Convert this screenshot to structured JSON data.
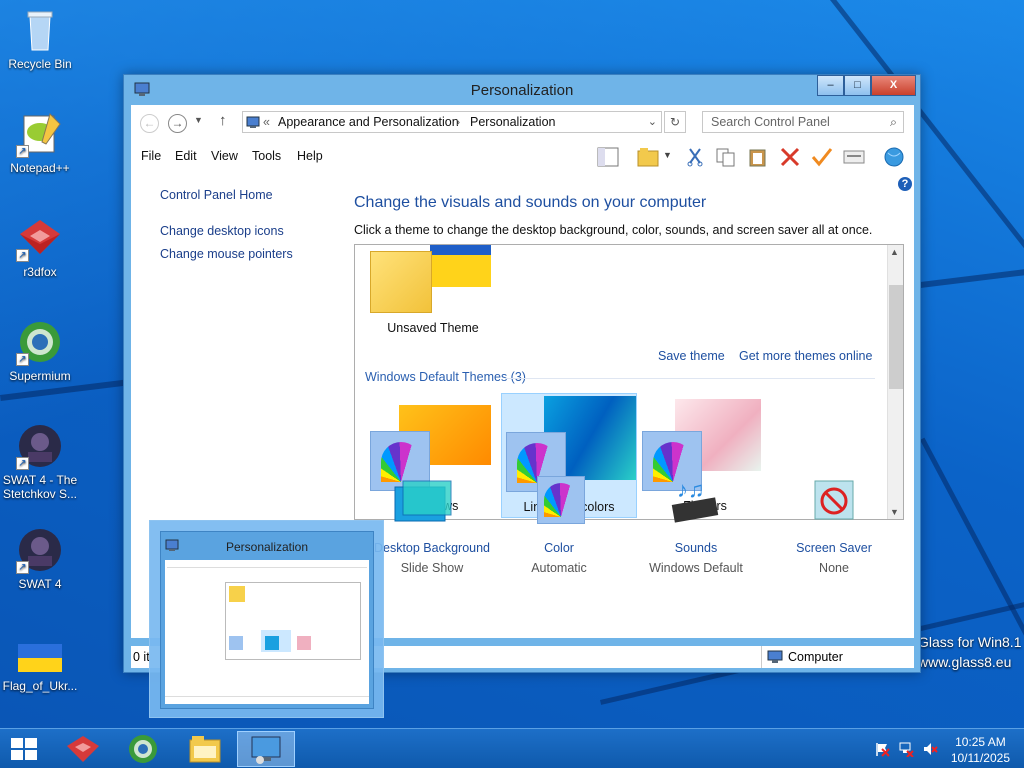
{
  "desktop": {
    "icons": [
      {
        "label": "Recycle Bin"
      },
      {
        "label": "Notepad++"
      },
      {
        "label": "r3dfox"
      },
      {
        "label": "Supermium"
      },
      {
        "label": "SWAT 4 - The Stetchkov S..."
      },
      {
        "label": "SWAT 4"
      },
      {
        "label": "Flag_of_Ukr..."
      }
    ],
    "watermark_line1": "Glass for Win8.1",
    "watermark_line2": "www.glass8.eu"
  },
  "window": {
    "title": "Personalization",
    "controls": {
      "minimize": "–",
      "maximize": "□",
      "close": "X"
    },
    "address": {
      "prefix": "«",
      "crumb1": "Appearance and Personalization",
      "sep": "›",
      "crumb2": "Personalization"
    },
    "search_placeholder": "Search Control Panel",
    "menu": [
      "File",
      "Edit",
      "View",
      "Tools",
      "Help"
    ],
    "sidebar": {
      "home": "Control Panel Home",
      "links": [
        "Change desktop icons",
        "Change mouse pointers"
      ]
    },
    "heading": "Change the visuals and sounds on your computer",
    "subtext": "Click a theme to change the desktop background, color, sounds, and screen saver all at once.",
    "my_themes": {
      "unsaved": "Unsaved Theme",
      "save_link": "Save theme",
      "more_link": "Get more themes online"
    },
    "default_section": "Windows Default Themes (3)",
    "default_themes": [
      "Windows",
      "Lines and colors",
      "Flowers"
    ],
    "selected_theme": "Lines and colors",
    "bottom": [
      {
        "label": "Desktop Background",
        "value": "Slide Show"
      },
      {
        "label": "Color",
        "value": "Automatic"
      },
      {
        "label": "Sounds",
        "value": "Windows Default"
      },
      {
        "label": "Screen Saver",
        "value": "None"
      }
    ],
    "status_left": "0 it",
    "status_right": "Computer",
    "help": "?"
  },
  "thumbnail": {
    "title": "Personalization"
  },
  "taskbar": {
    "clock_time": "10:25 AM",
    "clock_date": "10/11/2025"
  },
  "colors": {
    "accent": "#1e4fa0",
    "selection": "#cce8ff",
    "titlebar": "#6fb4e8"
  }
}
